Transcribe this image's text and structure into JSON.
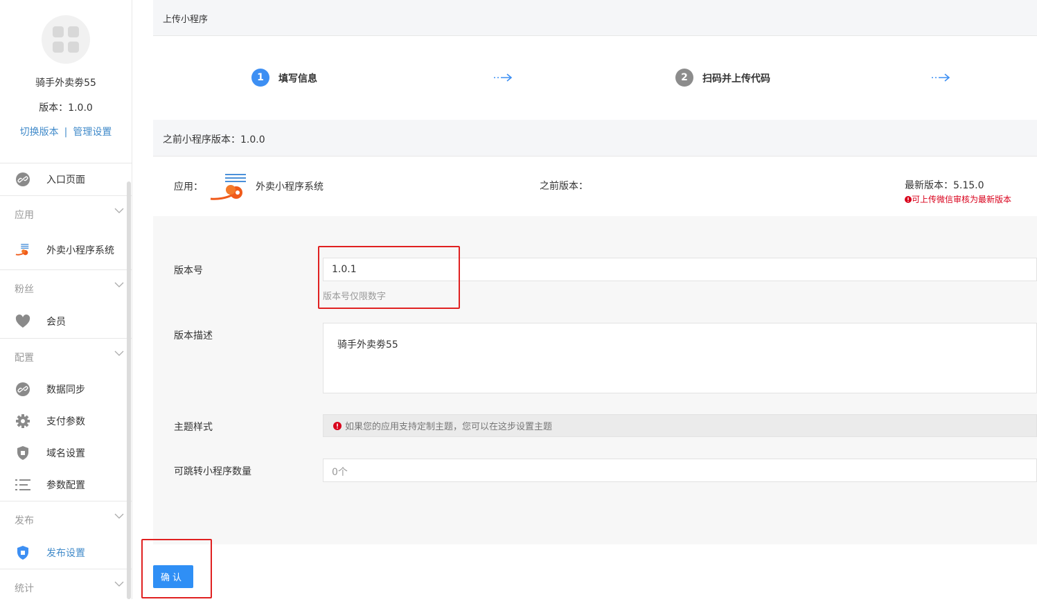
{
  "sidebar": {
    "app_name": "骑手外卖劵55",
    "version_text": "版本：1.0.0",
    "switch_version": "切换版本",
    "link_sep": "|",
    "manage_settings": "管理设置",
    "entry_page": "入口页面",
    "groups": {
      "apps": "应用",
      "fans": "粉丝",
      "config": "配置",
      "publish": "发布",
      "stats": "统计"
    },
    "items": {
      "takeaway": "外卖小程序系统",
      "member": "会员",
      "data_sync": "数据同步",
      "pay_params": "支付参数",
      "domain_settings": "域名设置",
      "param_config": "参数配置",
      "publish_settings": "发布设置"
    }
  },
  "main": {
    "title": "上传小程序",
    "steps": [
      {
        "num": "1",
        "label": "填写信息"
      },
      {
        "num": "2",
        "label": "扫码并上传代码"
      }
    ],
    "prev_version_bar": "之前小程序版本：1.0.0",
    "app_label": "应用：",
    "app_name": "外卖小程序系统",
    "prev_version_label": "之前版本：",
    "latest_version": "最新版本：5.15.0",
    "latest_note": "可上传微信审核为最新版本",
    "form": {
      "version_label": "版本号",
      "version_value": "1.0.1",
      "version_hint": "版本号仅限数字",
      "desc_label": "版本描述",
      "desc_value": "骑手外卖劵55",
      "theme_label": "主题样式",
      "theme_hint": "如果您的应用支持定制主题，您可以在这步设置主题",
      "jump_label": "可跳转小程序数量",
      "jump_value": "0个"
    },
    "confirm": "确认"
  },
  "colors": {
    "accent": "#2f8ff5",
    "link": "#428bca",
    "step_active": "#3d8ff3",
    "step_inactive": "#8c8c8c",
    "warning_red": "#d9001b",
    "highlight_box": "#e02020"
  }
}
